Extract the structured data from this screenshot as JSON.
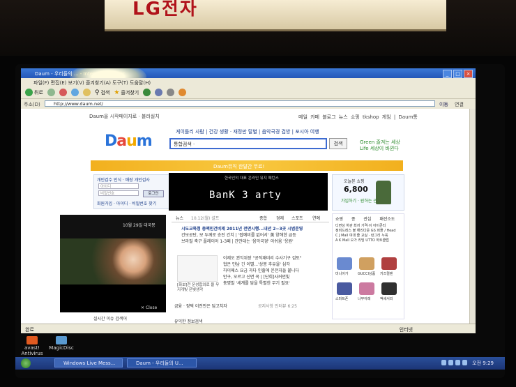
{
  "sign": {
    "text": "LG전자"
  },
  "window": {
    "title": "Daum - 우리들의 ... - Internet Explorer",
    "min": "_",
    "max": "□",
    "close": "×"
  },
  "menu": {
    "text": "파일(F)  편집(E)  보기(V)  즐겨찾기(A)  도구(T)  도움말(H)"
  },
  "toolbar": {
    "back": "뒤로",
    "search": "검색",
    "favorites": "즐겨찾기"
  },
  "address": {
    "label": "주소(D)",
    "url": "http://www.daum.net/",
    "go": "이동",
    "links": "연결"
  },
  "daum": {
    "top_left": "Daum을 시작페이지로 · 블러실치",
    "top_right": "메일 카페 블로그 뉴스 쇼핑 tkshop 게임 | Daum통",
    "logo": [
      "D",
      "a",
      "u",
      "m"
    ],
    "quick_links": "게이틀리 사람 | 건강 생활 · 재정만 탈별 | 음악국경 검방 | 포시아 여행",
    "search_placeholder": "통합검색 ·",
    "search_btn": "검색",
    "green_1": "Green 즐겨는 세상",
    "green_2": "Life 세상이 바뀐다",
    "banner": "Daum뮤직 한달간 무료!",
    "banner_sub": "한국인의 대표 온라인 뮤지 페턴스",
    "login_header": "개인검수 인식 · 매장 개인검사",
    "login_id": "아이디",
    "login_pw": "비밀번호",
    "login_btn": "로그인",
    "login_footer": "회원가입 · 아이디 · 비밀번호 찾기",
    "ad_text": "BanK 3 arty",
    "ad_small": "한국인의 대표 온라인 뮤지 패턴스",
    "today_title": "오늘본 쇼핑",
    "today_count": "6,800",
    "today_sub": "가입하기 · 원하는 관",
    "video_title": "10월 29일 대국몽",
    "video_close": "Close",
    "live_issue": "실시간 이슈 검색어",
    "news_tabs": [
      "뉴스",
      "10.12(월) 설프",
      "종합",
      "경제",
      "스포츠",
      "연예"
    ],
    "news_headline": "시도교육청 총액인건비제 2011년 전면시행...내년 2~3곳 시범운영",
    "news_lines": [
      "건보공단, 보 두께로 승진 간치 | '접예비를 없어서' 美 양해한 급등",
      "브라질 축구 플레이어 1-3패 | 간만대는 '음악국경' 아쉬움 '응원'"
    ],
    "news2_headline": "이제오 권익위장 \"공직재비리 수사기구 검토\"",
    "news2_lines": [
      "협은 만남 긴 이별...'상봉 추유을' 심각",
      "하이패스 요금 과다 인출에 운전자들 붙니다",
      "안구, 오르고 신면 꼭 | [단희]사커먼빛",
      "총명발 '세계를 담을 특별한 무기 필요'"
    ],
    "sketch_caption": "[화보]천 운성합의로 을 무지개빛 은빛생각",
    "ticker": "금융 · 정택 이전만은 답고치자",
    "notice": "공지사항 인터뷰 6:25",
    "info_bar": "유익한 정보검색",
    "shop_tabs": [
      "쇼핑 종",
      "관심",
      "패션소도"
    ],
    "shop_lines": [
      "디면상 하관 최저 가격·이 아이콘티",
      "정비드레스 불 해리다운 GS 퍼플 / Head",
      "C J Mall 여대 즐 교실 · 런그리 누육",
      "A K Mall 오가 리빙 UTTO 하트클럽"
    ],
    "shop_captions": [
      "미니아가",
      "GUCCI상품",
      "키즈컬렌",
      "스마트폰",
      "나무아래",
      "액세서리"
    ],
    "status_left": "완료",
    "status_right": "인터넷"
  },
  "desktop": [
    {
      "label": "avast! Antivirus"
    },
    {
      "label": "MagicDisc"
    }
  ],
  "taskbar": {
    "tasks": [
      "Windows Live Mess...",
      "Daum - 우리들의 U..."
    ],
    "clock": "오전 9:29"
  }
}
